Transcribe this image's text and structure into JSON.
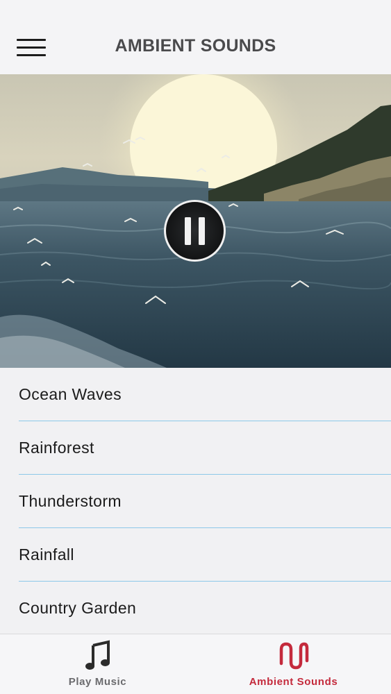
{
  "header": {
    "title": "AMBIENT SOUNDS",
    "menu_icon": "hamburger-menu-icon"
  },
  "player": {
    "state": "playing",
    "control_icon": "pause-icon"
  },
  "sounds": [
    {
      "label": "Ocean Waves"
    },
    {
      "label": "Rainforest"
    },
    {
      "label": "Thunderstorm"
    },
    {
      "label": "Rainfall"
    },
    {
      "label": "Country Garden"
    }
  ],
  "tabs": [
    {
      "label": "Play Music",
      "icon": "music-note-icon",
      "selected": false
    },
    {
      "label": "Ambient Sounds",
      "icon": "wave-icon",
      "selected": true
    }
  ],
  "colors": {
    "accent": "#c42a3c",
    "divider": "#8cc8e8",
    "title_text": "#4a4a4c"
  }
}
